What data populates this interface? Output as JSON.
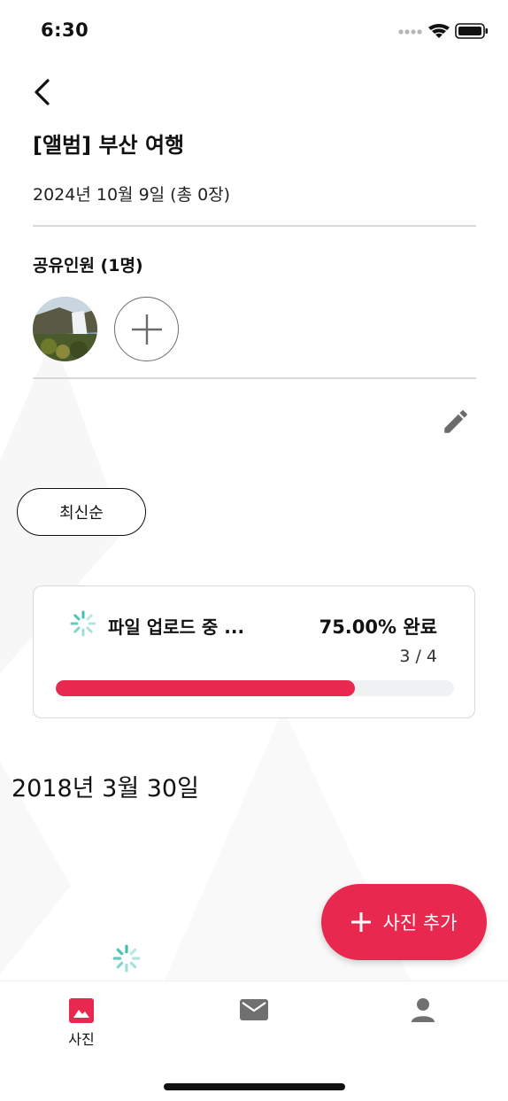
{
  "status_bar": {
    "time": "6:30"
  },
  "header": {
    "album_title": "[앨범] 부산 여행",
    "album_date": "2024년 10월 9일 (총 0장)"
  },
  "members": {
    "title": "공유인원 (1명)"
  },
  "sort": {
    "label": "최신순"
  },
  "upload": {
    "label": "파일 업로드 중 ...",
    "percent_text": "75.00% 완료",
    "count_text": "3 / 4",
    "progress": 0.75
  },
  "photos": {
    "date_group": "2018년 3월 30일"
  },
  "fab": {
    "label": "사진 추가"
  },
  "tab_bar": {
    "tabs": [
      {
        "label": "사진",
        "icon": "image-icon"
      },
      {
        "label": "",
        "icon": "mail-icon"
      },
      {
        "label": "",
        "icon": "person-icon"
      }
    ]
  },
  "colors": {
    "accent": "#e8284f",
    "spinner": "#3fbfae"
  }
}
